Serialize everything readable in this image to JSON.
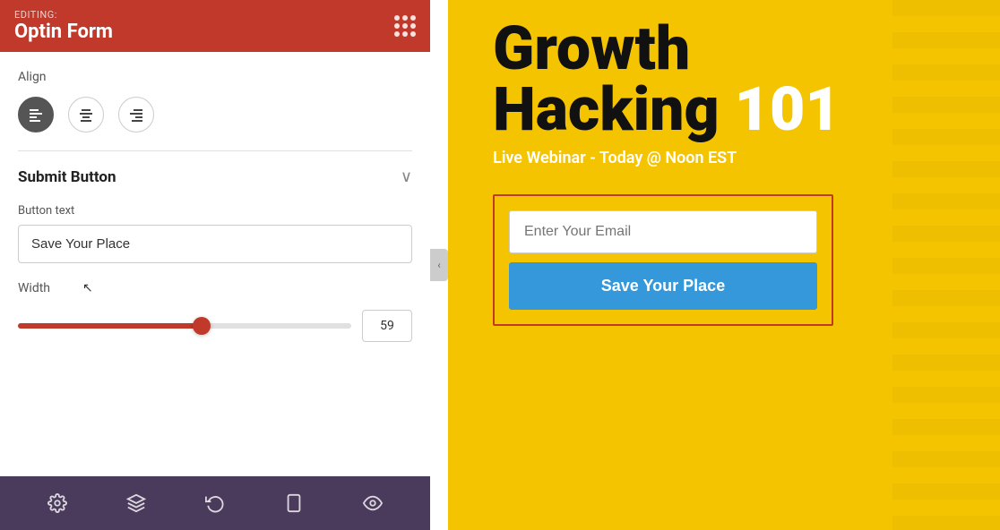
{
  "header": {
    "editing_label": "EDITING:",
    "title": "Optin Form"
  },
  "align_section": {
    "label": "Align"
  },
  "submit_button_section": {
    "title": "Submit Button",
    "button_text_label": "Button text",
    "button_text_value": "Save Your Place",
    "width_label": "Width",
    "width_value": "59"
  },
  "bottom_toolbar": {
    "gear_icon": "⚙",
    "layers_icon": "◈",
    "history_icon": "⟳",
    "mobile_icon": "📱",
    "preview_icon": "👁"
  },
  "right_panel": {
    "hero_title_line1": "Growth",
    "hero_title_line2": "Hacking",
    "hero_title_number": "101",
    "subtitle": "Live Webinar - Today @ Noon EST",
    "email_placeholder": "Enter Your Email",
    "submit_button_label": "Save Your Place"
  },
  "icons": {
    "chevron_down": "∨",
    "arrow_left_panel": "‹",
    "align_left": "⊢",
    "align_center": "⊣⊢",
    "align_right": "⊣"
  }
}
